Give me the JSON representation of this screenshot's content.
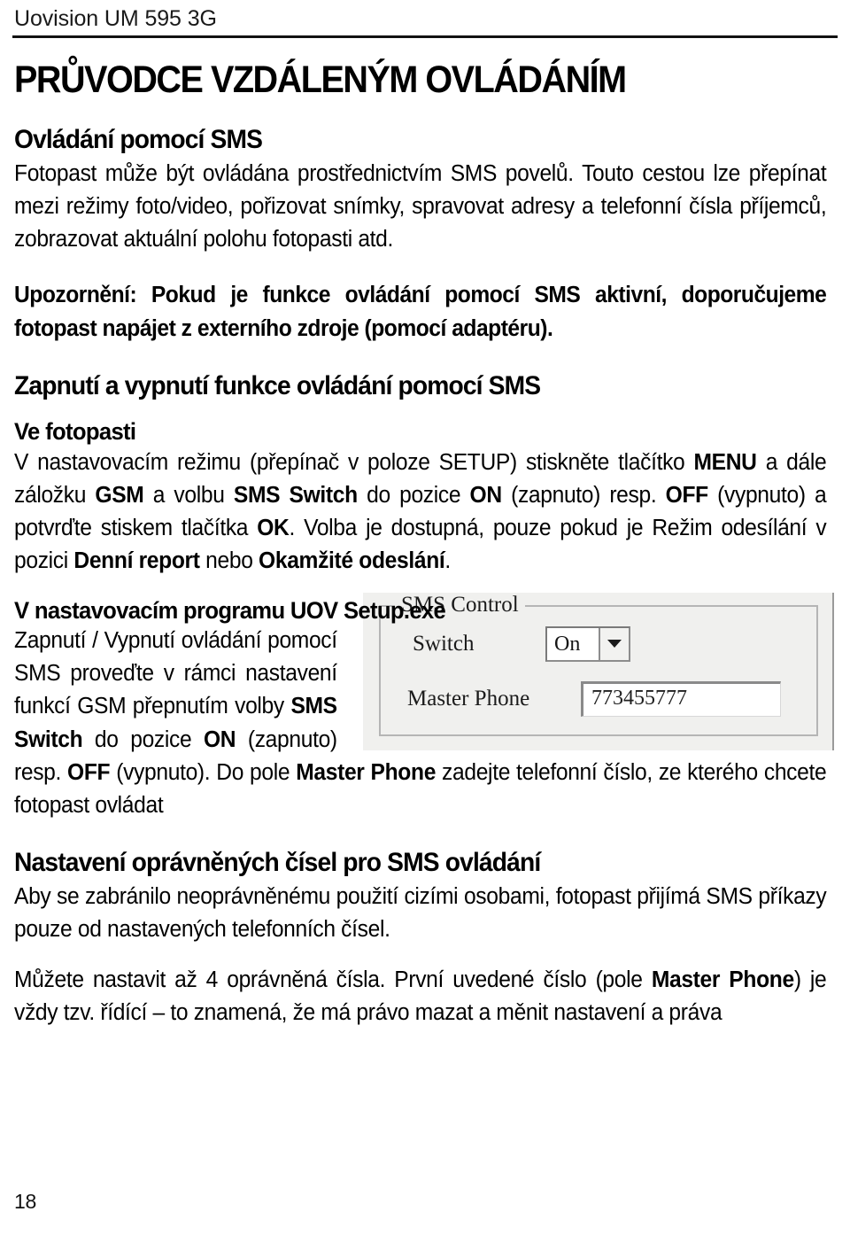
{
  "header": {
    "running_head": "Uovision UM 595 3G"
  },
  "title": "PRŮVODCE VZDÁLENÝM OVLÁDÁNÍM",
  "sections": {
    "sms_control": {
      "heading": "Ovládání pomocí SMS",
      "intro": "Fotopast může být ovládána prostřednictvím SMS povelů. Touto cestou lze přepínat mezi režimy foto/video, pořizovat snímky, spravovat adresy a telefonní čísla příjemců, zobrazovat aktuální polohu fotopasti atd.",
      "notice_label": "Upozornění:",
      "notice_text": " Pokud je funkce ovládání pomocí SMS aktivní, doporučujeme fotopast napájet z externího zdroje (pomocí adaptéru)."
    },
    "toggle_sms": {
      "heading": "Zapnutí a vypnutí funkce ovládání pomocí SMS",
      "in_camera": {
        "sub_heading": "Ve fotopasti",
        "p1_a": "V nastavovacím režimu (přepínač v poloze SETUP) stiskněte tlačítko ",
        "p1_menu": "MENU",
        "p1_b": " a dále záložku ",
        "p1_gsm": "GSM",
        "p1_c": " a volbu ",
        "p1_sms_switch": "SMS Switch",
        "p1_d": " do pozice ",
        "p1_on": "ON",
        "p1_e": " (zapnuto) resp. ",
        "p1_off": "OFF",
        "p1_f": " (vypnuto) a potvrďte stiskem tlačítka ",
        "p1_ok": "OK",
        "p1_g": ". Volba je dostupná, pouze pokud je Režim odesílání v pozici ",
        "p1_daily": "Denní report",
        "p1_h": " nebo ",
        "p1_instant": "Okamžité odeslání",
        "p1_i": "."
      },
      "in_setup_exe": {
        "sub_heading": "V nastavovacím programu UOV Setup.exe",
        "p2_a": "Zapnutí / Vypnutí ovládání pomocí SMS proveďte v rámci nastavení funkcí GSM přepnutím volby ",
        "p2_sms_switch": "SMS Switch",
        "p2_b": " do pozice ",
        "p2_on": "ON",
        "p2_c": " (zapnuto) resp. ",
        "p2_off": "OFF",
        "p2_d": " (vypnuto). Do pole ",
        "p2_master_phone": "Master Phone",
        "p2_e": " zadejte telefonní číslo, ze kterého chcete fotopast ovládat"
      }
    },
    "authorized_numbers": {
      "heading": "Nastavení oprávněných čísel pro SMS ovládání",
      "p1": "Aby se zabránilo neoprávněnému použití cizími osobami, fotopast přijímá SMS příkazy pouze od nastavených telefonních čísel.",
      "p2_a": "Můžete nastavit až 4 oprávněná čísla. První uvedené číslo (pole ",
      "p2_master_phone": "Master Phone",
      "p2_b": ") je vždy tzv. řídící – to znamená, že má právo mazat a měnit nastavení a práva"
    }
  },
  "app_screenshot": {
    "groupbox_title": "SMS Control",
    "switch_label": "Switch",
    "switch_value": "On",
    "master_phone_label": "Master Phone",
    "master_phone_value": "773455777"
  },
  "footer": {
    "page_number": "18"
  }
}
